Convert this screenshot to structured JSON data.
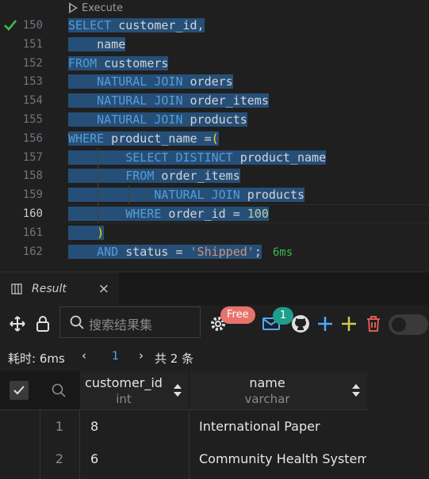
{
  "editor": {
    "codelens_label": "Execute",
    "timing": "6ms",
    "lines": [
      {
        "num": "150",
        "tokens": [
          [
            "kw",
            "SELECT"
          ],
          [
            "pl",
            " customer_id,"
          ]
        ]
      },
      {
        "num": "151",
        "tokens": [
          [
            "pl",
            "    name"
          ]
        ]
      },
      {
        "num": "152",
        "tokens": [
          [
            "kw",
            "FROM"
          ],
          [
            "pl",
            " customers"
          ]
        ]
      },
      {
        "num": "153",
        "tokens": [
          [
            "pl",
            "    "
          ],
          [
            "kw",
            "NATURAL JOIN"
          ],
          [
            "pl",
            " orders"
          ]
        ]
      },
      {
        "num": "154",
        "tokens": [
          [
            "pl",
            "    "
          ],
          [
            "kw",
            "NATURAL JOIN"
          ],
          [
            "pl",
            " order_items"
          ]
        ]
      },
      {
        "num": "155",
        "tokens": [
          [
            "pl",
            "    "
          ],
          [
            "kw",
            "NATURAL JOIN"
          ],
          [
            "pl",
            " products"
          ]
        ]
      },
      {
        "num": "156",
        "tokens": [
          [
            "kw",
            "WHERE"
          ],
          [
            "pl",
            " product_name ="
          ],
          [
            "paren",
            "("
          ]
        ]
      },
      {
        "num": "157",
        "tokens": [
          [
            "pl",
            "        "
          ],
          [
            "kw",
            "SELECT DISTINCT"
          ],
          [
            "pl",
            " product_name"
          ]
        ]
      },
      {
        "num": "158",
        "tokens": [
          [
            "pl",
            "        "
          ],
          [
            "kw",
            "FROM"
          ],
          [
            "pl",
            " order_items"
          ]
        ]
      },
      {
        "num": "159",
        "tokens": [
          [
            "pl",
            "            "
          ],
          [
            "kw",
            "NATURAL JOIN"
          ],
          [
            "pl",
            " products"
          ]
        ]
      },
      {
        "num": "160",
        "tokens": [
          [
            "pl",
            "        "
          ],
          [
            "kw",
            "WHERE"
          ],
          [
            "pl",
            " order_id = "
          ],
          [
            "num",
            "100"
          ]
        ]
      },
      {
        "num": "161",
        "tokens": [
          [
            "pl",
            "    "
          ],
          [
            "paren",
            ")"
          ]
        ]
      },
      {
        "num": "162",
        "tokens": [
          [
            "pl",
            "    "
          ],
          [
            "kw",
            "AND"
          ],
          [
            "pl",
            " status = "
          ],
          [
            "str",
            "'Shipped'"
          ],
          [
            "pl",
            ";"
          ]
        ]
      }
    ]
  },
  "panel": {
    "tab_label": "Result",
    "close_glyph": "×"
  },
  "toolbar": {
    "search_placeholder": "搜索结果集",
    "free_badge": "Free",
    "mail_count": "1"
  },
  "pager": {
    "elapsed": "耗时: 6ms",
    "prev_glyph": "‹",
    "page": "1",
    "next_glyph": "›",
    "total": "共 2 条"
  },
  "grid": {
    "columns": [
      {
        "name": "customer_id",
        "type": "int"
      },
      {
        "name": "name",
        "type": "varchar"
      }
    ],
    "rows": [
      {
        "index": "1",
        "customer_id": "8",
        "name": "International Paper"
      },
      {
        "index": "2",
        "customer_id": "6",
        "name": "Community Health Systems"
      }
    ]
  },
  "colors": {
    "selection": "#264f78",
    "keyword": "#569cd6",
    "success": "#3fb950",
    "link": "#4daafc"
  },
  "icons": [
    "play-icon",
    "check-icon",
    "result-tab-icon",
    "move-icon",
    "lock-icon",
    "search-icon",
    "gear-icon",
    "mail-icon",
    "github-icon",
    "add-row-icon",
    "add-icon",
    "delete-icon"
  ]
}
